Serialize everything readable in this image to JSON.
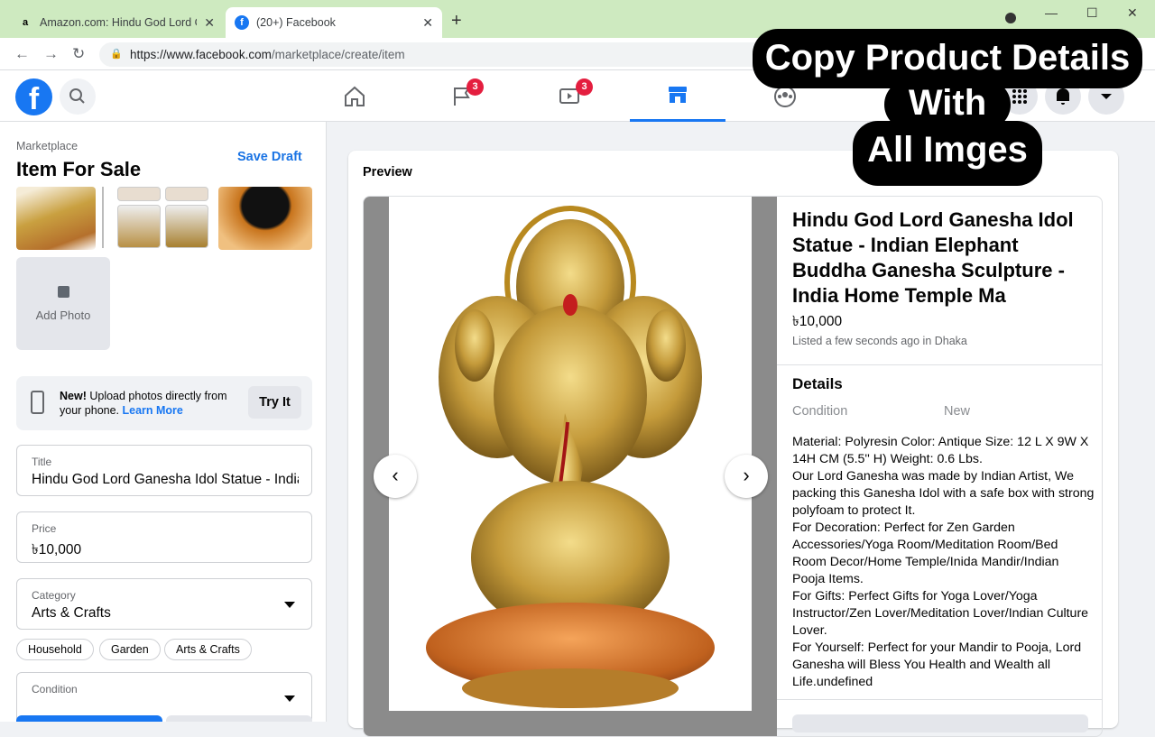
{
  "browser": {
    "tabs": [
      {
        "title": "Amazon.com: Hindu God Lord Ga",
        "favicon": "amazon-icon",
        "active": false
      },
      {
        "title": "(20+) Facebook",
        "favicon": "facebook-icon",
        "active": true
      }
    ],
    "new_tab": "+",
    "url_host": "https://www.facebook.com",
    "url_path": "/marketplace/create/item"
  },
  "fb_nav": {
    "logo": "f",
    "badges": {
      "pages": "3",
      "watch": "3"
    },
    "active_item": "marketplace"
  },
  "sidebar": {
    "breadcrumb": "Marketplace",
    "title": "Item For Sale",
    "save_draft": "Save Draft",
    "add_photo": "Add Photo",
    "upload_promo": {
      "bold": "New!",
      "text": " Upload photos directly from your phone. ",
      "link": "Learn More"
    },
    "try_it": "Try It",
    "title_field": {
      "label": "Title",
      "value": "Hindu God Lord Ganesha Idol Statue - Indian Elephant Buddha Ganesha Sculpture - India Home Temple Ma"
    },
    "price_field": {
      "label": "Price",
      "value": "৳10,000"
    },
    "category_field": {
      "label": "Category",
      "value": "Arts & Crafts"
    },
    "chips": [
      "Household",
      "Garden",
      "Arts & Crafts"
    ],
    "condition_field": {
      "label": "Condition",
      "value": ""
    }
  },
  "preview": {
    "label": "Preview",
    "title": "Hindu God Lord Ganesha Idol Statue - Indian Elephant Buddha Ganesha Sculpture - India Home Temple Ma",
    "price": "৳10,000",
    "listed": "Listed a few seconds ago in Dhaka",
    "details_header": "Details",
    "condition_label": "Condition",
    "condition_value": "New",
    "description": [
      "Material: Polyresin Color: Antique Size: 12 L X 9W X 14H CM (5.5'' H) Weight: 0.6 Lbs.",
      "Our Lord Ganesha was made by Indian Artist, We packing this Ganesha Idol with a safe box with strong polyfoam to protect It.",
      "For Decoration: Perfect for Zen Garden Accessories/Yoga Room/Meditation Room/Bed Room Decor/Home Temple/Inida Mandir/Indian Pooja Items.",
      "For Gifts: Perfect Gifts for Yoga Lover/Yoga Instructor/Zen Lover/Meditation Lover/Indian Culture Lover.",
      "For Yourself: Perfect for your Mandir to Pooja, Lord Ganesha will Bless You Health and Wealth all Life.undefined"
    ],
    "prev_arrow": "‹",
    "next_arrow": "›"
  },
  "overlay": {
    "line1": "Copy Product Details",
    "line2": "With",
    "line3": "All Imges"
  },
  "colors": {
    "fb_blue": "#1877f2",
    "badge_red": "#e41e3f",
    "tab_bar": "#ceeac0"
  }
}
